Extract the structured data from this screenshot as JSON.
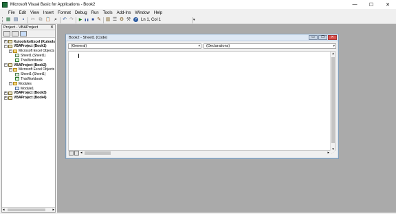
{
  "window": {
    "title": "Microsoft Visual Basic for Applications - Book2",
    "controls": [
      "—",
      "☐",
      "✕"
    ]
  },
  "menu": [
    "File",
    "Edit",
    "View",
    "Insert",
    "Format",
    "Debug",
    "Run",
    "Tools",
    "Add-Ins",
    "Window",
    "Help"
  ],
  "toolbar": {
    "icons": [
      "excel-icon",
      "insert-module-icon",
      "save-icon",
      "cut-icon",
      "copy-icon",
      "paste-icon",
      "find-icon",
      "undo-icon",
      "redo-icon",
      "run-icon",
      "break-icon",
      "reset-icon",
      "design-mode-icon",
      "project-explorer-icon",
      "properties-icon",
      "object-browser-icon",
      "toolbox-icon",
      "help-icon"
    ],
    "glyphs": [
      "▦",
      "▤",
      "▪",
      "✂",
      "⧉",
      "📋",
      "⌕",
      "↶",
      "↷",
      "▶",
      "❚❚",
      "■",
      "✎",
      "▥",
      "☰",
      "⚙",
      "⚒",
      "?"
    ],
    "status": "Ln 1, Col 1"
  },
  "project_panel": {
    "title": "Project - VBAProject",
    "close": "✕",
    "tree": [
      {
        "label": "KutoolsforExcel (Kutools_Loadin",
        "level": 0,
        "expander": "+",
        "icon": "project-icon",
        "bold": true
      },
      {
        "label": "VBAProject (Book1)",
        "level": 0,
        "expander": "−",
        "icon": "project-icon",
        "bold": true
      },
      {
        "label": "Microsoft Excel Objects",
        "level": 1,
        "expander": "−",
        "icon": "folder-icon",
        "bold": false
      },
      {
        "label": "Sheet1 (Sheet1)",
        "level": 2,
        "expander": "",
        "icon": "sheet-icon",
        "bold": false
      },
      {
        "label": "ThisWorkbook",
        "level": 2,
        "expander": "",
        "icon": "workbook-icon",
        "bold": false
      },
      {
        "label": "VBAProject (Book2)",
        "level": 0,
        "expander": "−",
        "icon": "project-icon",
        "bold": true
      },
      {
        "label": "Microsoft Excel Objects",
        "level": 1,
        "expander": "−",
        "icon": "folder-icon",
        "bold": false
      },
      {
        "label": "Sheet1 (Sheet1)",
        "level": 2,
        "expander": "",
        "icon": "sheet-icon",
        "bold": false
      },
      {
        "label": "ThisWorkbook",
        "level": 2,
        "expander": "",
        "icon": "workbook-icon",
        "bold": false
      },
      {
        "label": "Modules",
        "level": 1,
        "expander": "−",
        "icon": "folder-icon",
        "bold": false
      },
      {
        "label": "Module1",
        "level": 2,
        "expander": "",
        "icon": "module-icon",
        "bold": false
      },
      {
        "label": "VBAProject (Book3)",
        "level": 0,
        "expander": "+",
        "icon": "project-icon",
        "bold": true
      },
      {
        "label": "VBAProject (Book4)",
        "level": 0,
        "expander": "+",
        "icon": "project-icon",
        "bold": true
      }
    ]
  },
  "code_window": {
    "title": "Book2 - Sheet1 (Code)",
    "object_combo": "(General)",
    "procedure_combo": "(Declarations)",
    "controls": [
      "▭",
      "❐",
      "✕"
    ],
    "arrows": {
      "down": "▾",
      "up": "▴",
      "left": "◂",
      "right": "▸"
    },
    "grip": "⋰"
  }
}
